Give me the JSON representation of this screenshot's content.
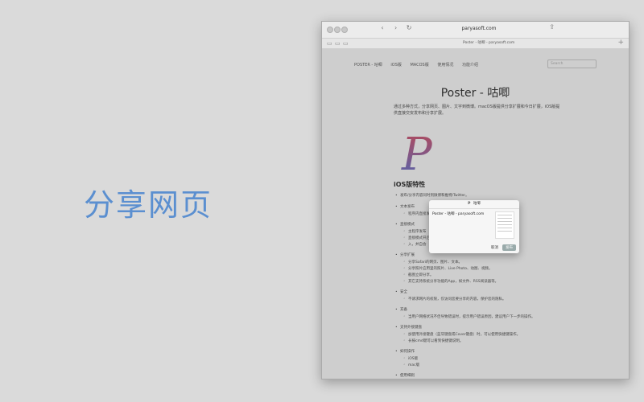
{
  "headline": "分享网页",
  "browser": {
    "address": "paryasoft.com",
    "tab_label": "Poster - 咕唧 - paryasoft.com",
    "nav_back": "‹",
    "nav_forward": "›",
    "reload": "↻"
  },
  "site": {
    "nav": [
      "POSTER - 咕唧",
      "iOS版",
      "MACOS版",
      "使用情况",
      "功能介绍"
    ],
    "search_placeholder": "Search",
    "title": "Poster - 咕唧",
    "intro": "通过多种方式，分享网页、图片、文字到微博。macOS版提供分享扩展和今日扩展，iOS版提供直接交安发布和分享扩展。",
    "logo_letter": "P",
    "section_title": "iOS版特性",
    "features": [
      {
        "title": "发布/分享内容同时到微博和推特/Twitter。",
        "subs": []
      },
      {
        "title": "文本发布",
        "subs": [
          "程序内直接发布"
        ]
      },
      {
        "title": "直接模式",
        "subs": [
          "主程序发布",
          "直接模式开启",
          "入，并自会"
        ]
      },
      {
        "title": "分享扩展",
        "subs": [
          "分享Safari的网页、图片、文本。",
          "分享照片应用里的照片、Live Photo、动图、视频。",
          "截图立即分享。",
          "其它支持系统分享功能的App，如文件、RSS阅读器等。"
        ]
      },
      {
        "title": "安全",
        "subs": [
          "不请求网片的权限，仅访问您要分享的内容，保护您的隐私。"
        ]
      },
      {
        "title": "充备",
        "subs": [
          "当用户网络状况不佳导致错误时，提示用户错误原因，建议用户下一步的操作。"
        ]
      },
      {
        "title": "支持外接键盘",
        "subs": [
          "加使用外接键盘（蓝牙键盘或Cover键盘）时，可以使用快捷键操作。",
          "长按cmd键可以看到快捷键说明。"
        ]
      },
      {
        "title": "如何操作",
        "subs": [
          "iOS版",
          "mac版"
        ]
      },
      {
        "title": "使用细则",
        "subs": [
          "微博API要求分享的必须包含一个已知的链接用于验证，微博无此要求。",
          "Live Photo只能取出静态的图片，如果分享的视频部分，可以使用内置的功能将其转换为动图，具体操作方式见如有文档。",
          "微博只可以分享1张照片，微博最多可以分享4张。",
          "微博不支持分享视频。分享到微博的视频，实际上是上传到你的，微博可以分享视频。"
        ]
      }
    ]
  },
  "share_sheet": {
    "app_icon": "P",
    "app_name": "咕唧",
    "text": "Poster - 咕唧 - paryasoft.com",
    "cancel_label": "取消",
    "post_label": "发布"
  }
}
